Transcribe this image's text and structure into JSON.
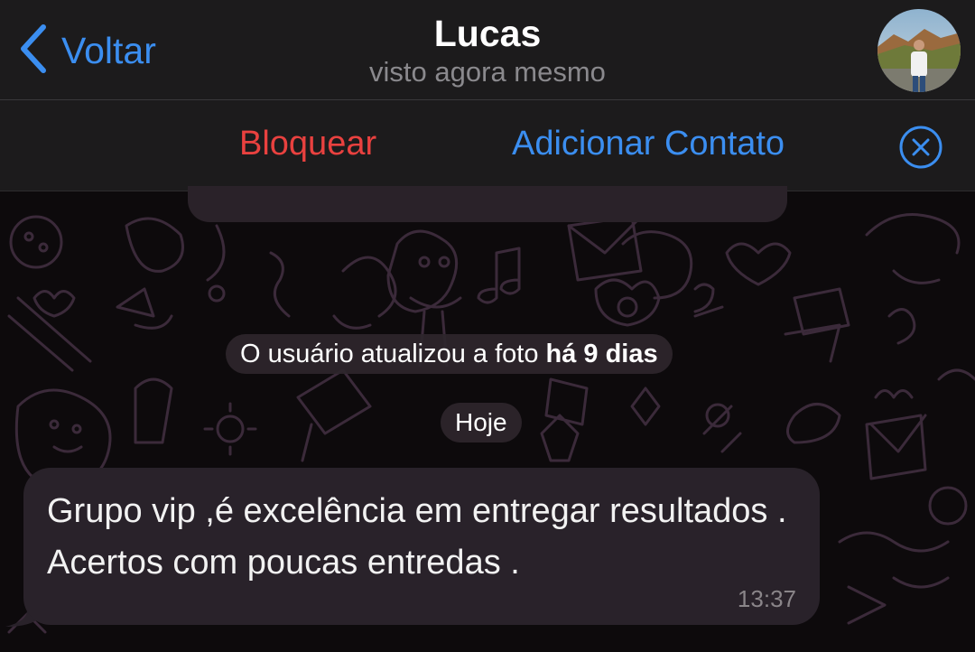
{
  "header": {
    "back_label": "Voltar",
    "contact_name": "Lucas",
    "status": "visto agora mesmo"
  },
  "action_bar": {
    "block_label": "Bloquear",
    "add_contact_label": "Adicionar Contato"
  },
  "chat": {
    "service_message": {
      "text": "O usuário atualizou a foto",
      "emphasis": "há 9 dias"
    },
    "date_separator": "Hoje",
    "messages": [
      {
        "text": "Grupo vip ,é excelência em entregar resultados . Acertos com poucas entredas .",
        "time": "13:37",
        "direction": "incoming"
      }
    ]
  },
  "colors": {
    "accent_blue": "#3b8ef0",
    "danger_red": "#e9413f",
    "bar_background": "#1c1b1c",
    "bubble_background": "#29222a"
  },
  "icons": {
    "back": "chevron-left-icon",
    "dismiss": "close-circle-icon",
    "avatar": "contact-avatar-photo"
  }
}
